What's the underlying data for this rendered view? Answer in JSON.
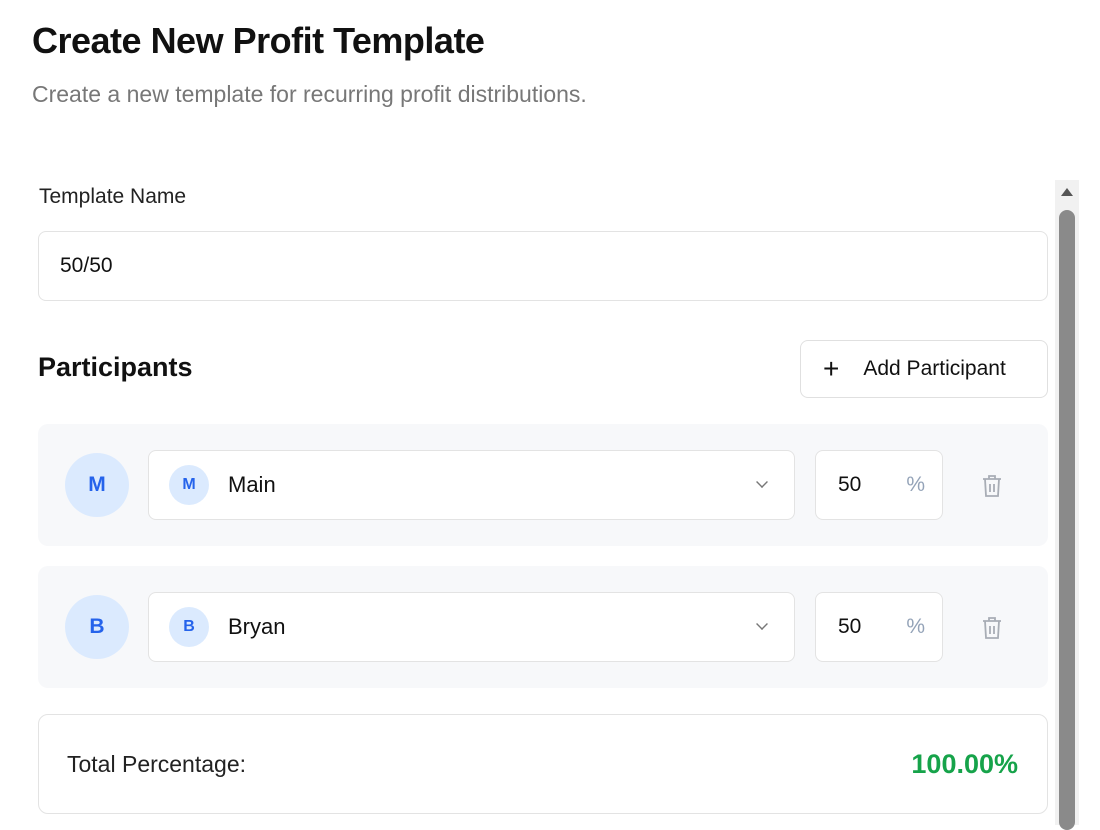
{
  "header": {
    "title": "Create New Profit Template",
    "subtitle": "Create a new template for recurring profit distributions."
  },
  "form": {
    "template_name_label": "Template Name",
    "template_name_value": "50/50"
  },
  "participants": {
    "heading": "Participants",
    "add_label": "Add Participant",
    "add_icon": "+",
    "items": [
      {
        "initial": "M",
        "name": "Main",
        "percent": "50",
        "unit": "%"
      },
      {
        "initial": "B",
        "name": "Bryan",
        "percent": "50",
        "unit": "%"
      }
    ]
  },
  "total": {
    "label": "Total Percentage:",
    "value": "100.00%",
    "color": "#16a34a"
  }
}
